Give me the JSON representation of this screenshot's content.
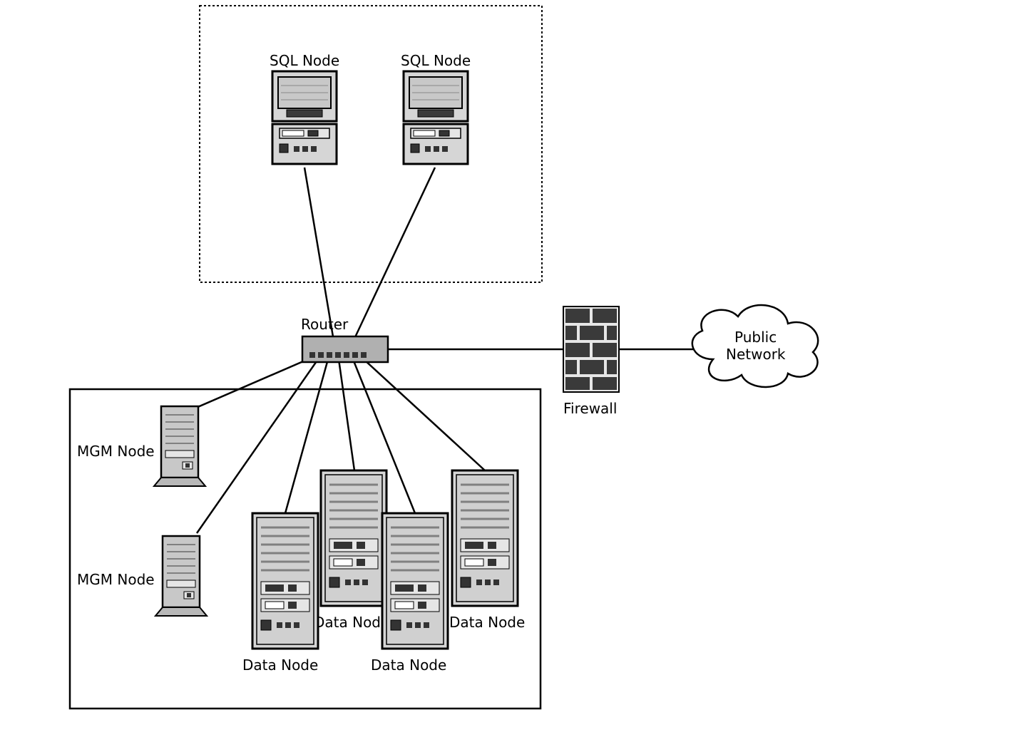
{
  "labels": {
    "sql_node_1": "SQL Node",
    "sql_node_2": "SQL Node",
    "router": "Router",
    "firewall": "Firewall",
    "public_network_l1": "Public",
    "public_network_l2": "Network",
    "mgm_node_1": "MGM Node",
    "mgm_node_2": "MGM Node",
    "data_node_1": "Data Node",
    "data_node_2": "Data Node",
    "data_node_3": "Data Node",
    "data_node_4": "Data Node"
  },
  "diagram": {
    "type": "network",
    "zones": [
      {
        "name": "sql-zone",
        "style": "dotted",
        "contains": [
          "sql-node-1",
          "sql-node-2"
        ]
      },
      {
        "name": "data-zone",
        "style": "solid",
        "contains": [
          "mgm-node-1",
          "mgm-node-2",
          "data-node-1",
          "data-node-2",
          "data-node-3",
          "data-node-4"
        ]
      }
    ],
    "nodes": [
      {
        "id": "sql-node-1",
        "kind": "workstation"
      },
      {
        "id": "sql-node-2",
        "kind": "workstation"
      },
      {
        "id": "router",
        "kind": "router"
      },
      {
        "id": "firewall",
        "kind": "firewall"
      },
      {
        "id": "public-network",
        "kind": "cloud"
      },
      {
        "id": "mgm-node-1",
        "kind": "server-small"
      },
      {
        "id": "mgm-node-2",
        "kind": "server-small"
      },
      {
        "id": "data-node-1",
        "kind": "server-tower"
      },
      {
        "id": "data-node-2",
        "kind": "server-tower"
      },
      {
        "id": "data-node-3",
        "kind": "server-tower"
      },
      {
        "id": "data-node-4",
        "kind": "server-tower"
      }
    ],
    "edges": [
      [
        "sql-node-1",
        "router"
      ],
      [
        "sql-node-2",
        "router"
      ],
      [
        "mgm-node-1",
        "router"
      ],
      [
        "mgm-node-2",
        "router"
      ],
      [
        "data-node-1",
        "router"
      ],
      [
        "data-node-2",
        "router"
      ],
      [
        "data-node-3",
        "router"
      ],
      [
        "data-node-4",
        "router"
      ],
      [
        "router",
        "firewall"
      ],
      [
        "firewall",
        "public-network"
      ]
    ]
  }
}
